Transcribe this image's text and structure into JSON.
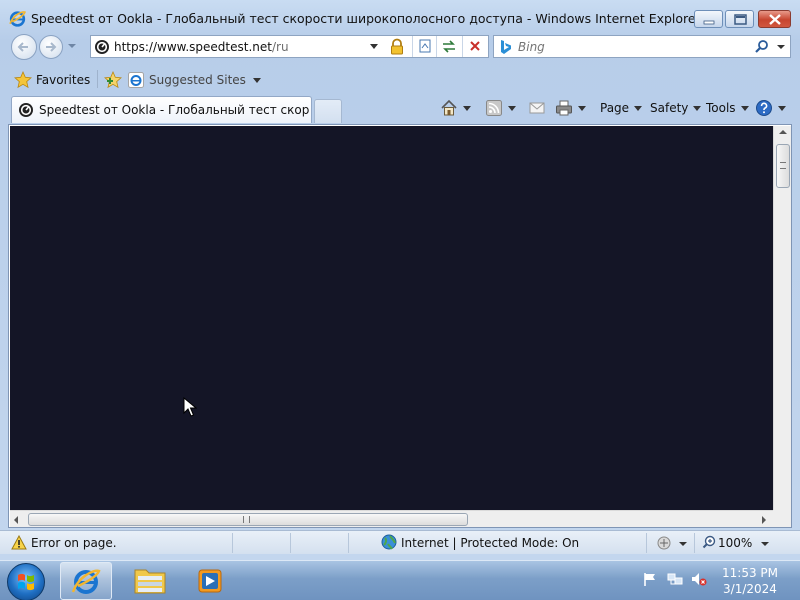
{
  "window": {
    "title": "Speedtest от Ookla - Глобальный тест скорости широкополосного доступа - Windows Internet Explorer"
  },
  "address_bar": {
    "url_host": "https://www.speedtest.net",
    "url_path": "/ru"
  },
  "search": {
    "placeholder": "Bing"
  },
  "favorites_bar": {
    "favorites_label": "Favorites",
    "suggested_label": "Suggested Sites"
  },
  "tab": {
    "label": "Speedtest от Ookla - Глобальный тест скорости..."
  },
  "command_bar": {
    "page_label": "Page",
    "safety_label": "Safety",
    "tools_label": "Tools"
  },
  "status_bar": {
    "message": "Error on page.",
    "zone": "Internet | Protected Mode: On",
    "zoom": "100%"
  },
  "clock": {
    "time": "11:53 PM",
    "date": "3/1/2024"
  },
  "colors": {
    "page_background": "#141526",
    "chrome_blue": "#c9dcf2",
    "close_red": "#c7452f"
  },
  "icons": [
    "ie-icon",
    "back-icon",
    "forward-icon",
    "lock-icon",
    "compat-view-icon",
    "refresh-icon",
    "stop-icon",
    "bing-icon",
    "search-icon",
    "favorites-star-icon",
    "add-favorite-icon",
    "suggested-sites-icon",
    "home-icon",
    "feeds-icon",
    "mail-icon",
    "print-icon",
    "help-icon",
    "warning-icon",
    "globe-icon",
    "zoom-icon",
    "windows-start-icon",
    "folder-icon",
    "media-player-icon",
    "flag-icon",
    "network-icon",
    "volume-muted-icon"
  ]
}
